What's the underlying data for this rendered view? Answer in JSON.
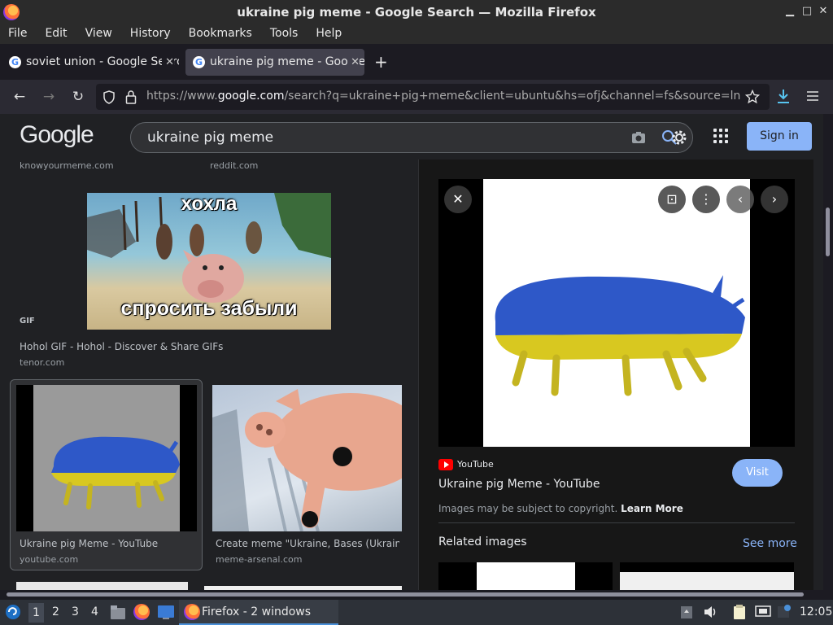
{
  "window": {
    "title": "ukraine pig meme - Google Search — Mozilla Firefox",
    "min": "▁",
    "max": "□",
    "close": "✕"
  },
  "menu": [
    "File",
    "Edit",
    "View",
    "History",
    "Bookmarks",
    "Tools",
    "Help"
  ],
  "tabs": [
    {
      "label": "soviet union - Google Search",
      "close": "✕"
    },
    {
      "label": "ukraine pig meme - Google Search",
      "close": "✕"
    }
  ],
  "newtab": "+",
  "nav": {
    "back": "←",
    "forward": "→",
    "reload": "↻",
    "url_prefix": "https://www.",
    "url_domain": "google.com",
    "url_rest": "/search?q=ukraine+pig+meme&client=ubuntu&hs=ofj&channel=fs&source=lnms"
  },
  "google": {
    "logo": "Google",
    "query": "ukraine pig meme",
    "signin": "Sign in"
  },
  "results": {
    "top_sources": [
      "knowyourmeme.com",
      "reddit.com"
    ],
    "meme_top": "хохла",
    "meme_bottom": "спросить забыли",
    "gif_badge": "GIF",
    "r1_title": "Hohol GIF - Hohol - Discover & Share GIFs",
    "r1_source": "tenor.com",
    "r2_title": "Ukraine pig Meme - YouTube",
    "r2_source": "youtube.com",
    "r3_title": "Create meme \"Ukraine, Bases (Ukraine ...",
    "r3_source": "meme-arsenal.com"
  },
  "panel": {
    "site": "YouTube",
    "title": "Ukraine pig Meme - YouTube",
    "visit": "Visit",
    "copyright": "Images may be subject to copyright.",
    "learn_more": "Learn More",
    "related": "Related images",
    "see_more": "See more"
  },
  "taskbar": {
    "workspaces": [
      "1",
      "2",
      "3",
      "4"
    ],
    "task_label": "Firefox - 2 windows",
    "clock": "12:05"
  },
  "colors": {
    "accent": "#8ab4f8",
    "page_bg": "#202124",
    "ukraine_blue": "#2e58c8",
    "ukraine_yellow": "#d8c820"
  }
}
